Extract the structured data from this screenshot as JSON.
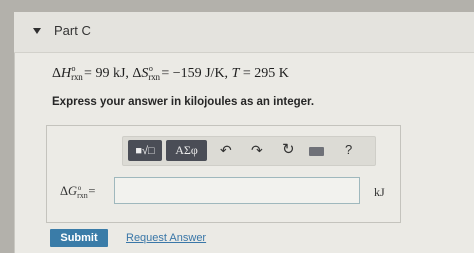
{
  "part": {
    "title": "Part C"
  },
  "problem": {
    "delta": "Δ",
    "h_symbol": "H",
    "s_symbol": "S",
    "g_symbol": "G",
    "rxn_sub": "rxn",
    "standard_sup": "o",
    "h_value": "= 99 kJ,",
    "s_value": "= −159 J/K,",
    "t_symbol": "T",
    "t_value": "= 295 K"
  },
  "instruction": "Express your answer in kilojoules as an integer.",
  "toolbar": {
    "matrix_label": "■√□",
    "greek_label": "ΑΣφ",
    "undo_glyph": "↶",
    "redo_glyph": "↷",
    "reset_glyph": "↻",
    "help_label": "?"
  },
  "answer": {
    "equals": "=",
    "value": "",
    "unit": "kJ"
  },
  "actions": {
    "submit_label": "Submit",
    "request_label": "Request Answer"
  },
  "colors": {
    "submit_bg": "#3a7ca8",
    "link": "#3a77a8"
  }
}
